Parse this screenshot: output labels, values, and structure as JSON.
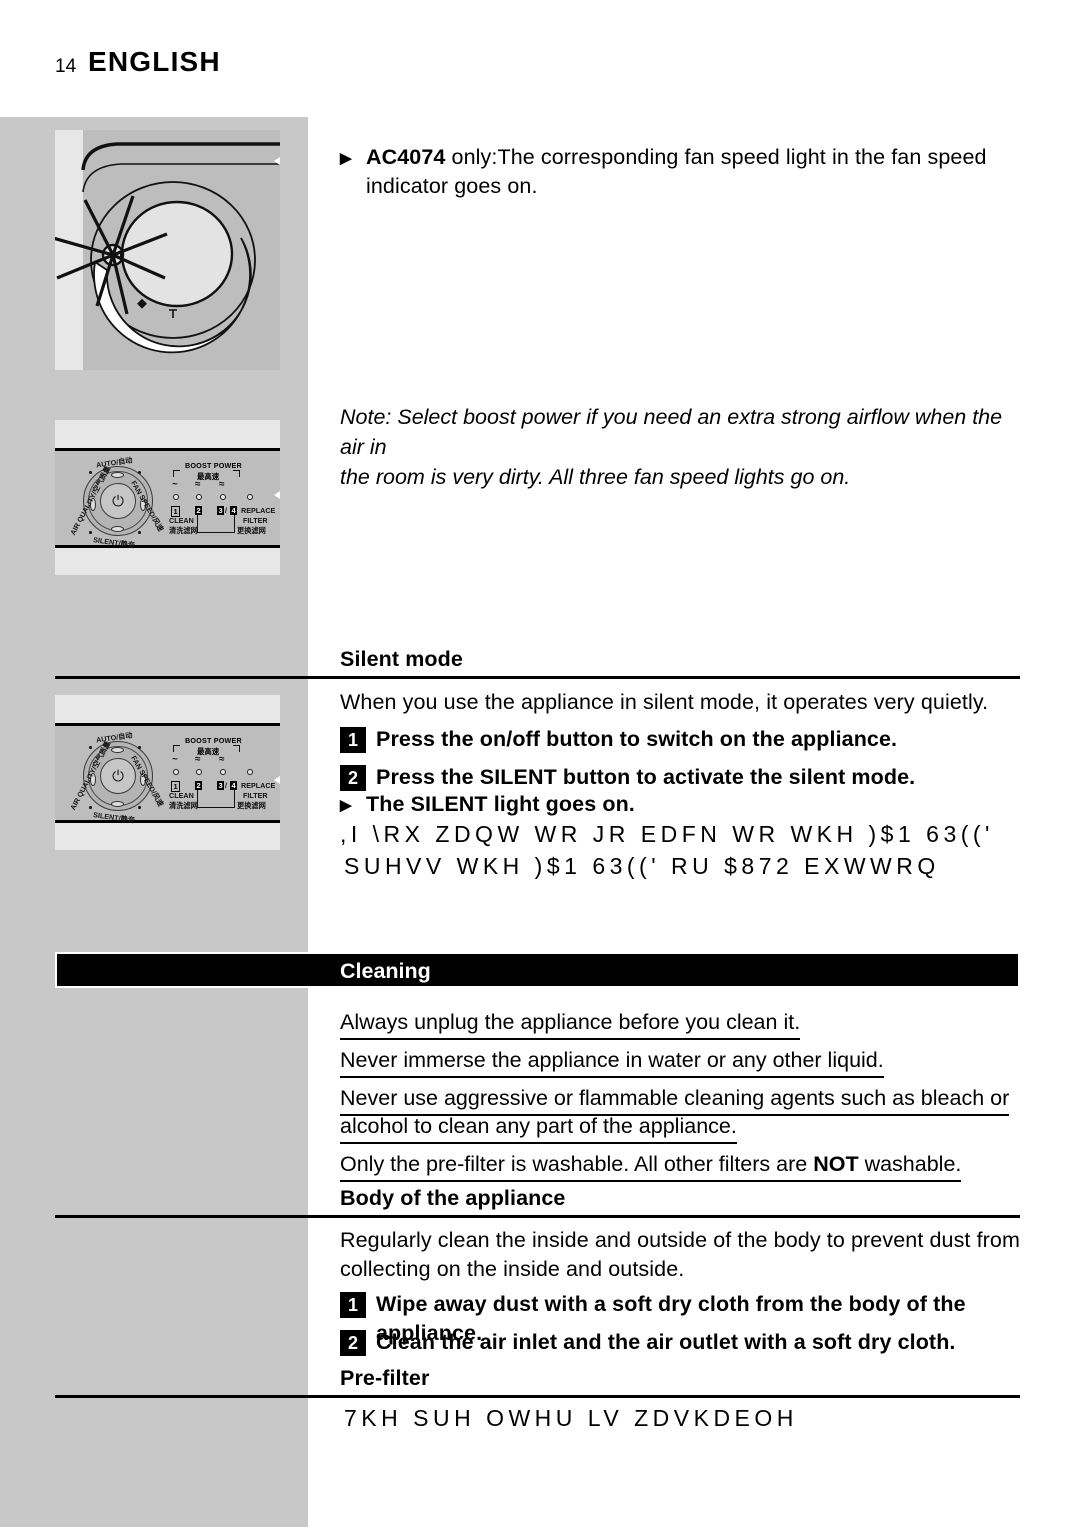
{
  "page": {
    "number": "14",
    "title": "ENGLISH"
  },
  "bullets": {
    "ac4074": {
      "bold_prefix": "AC4074",
      "rest": " only:The corresponding fan speed light in the fan speed",
      "line2": "indicator goes on."
    },
    "silent_light": {
      "pre": "The ",
      "bold": "SILENT",
      "post": " light goes on."
    }
  },
  "note": {
    "line1": "Note: Select boost power if you need an extra strong airflow when the air in",
    "line2": "the room is very dirty. All three fan speed lights go on."
  },
  "silent_mode": {
    "heading": "Silent mode",
    "intro": "When you use the appliance in silent mode, it operates very quietly.",
    "steps": [
      {
        "number": "1",
        "text": "Press the on/off button to switch on the appliance."
      },
      {
        "number": "2",
        "pre": "Press the ",
        "bold": "SILENT",
        "post": " button to activate the silent mode."
      }
    ],
    "garbled": [
      ",I \\RX ZDQW WR JR EDFN WR WKH )$1 63(('",
      "SUHVV WKH )$1 63((' RU $872 EXWWRQ"
    ]
  },
  "cleaning": {
    "banner_label": "Cleaning",
    "warnings": [
      "Always unplug the appliance before you clean it.",
      "Never immerse the appliance in water or any other liquid.",
      "Never use aggressive or flammable cleaning agents such as bleach or",
      "alcohol to clean any part of the appliance."
    ],
    "prefilter_note": {
      "pre": "Only the pre-filter is washable. All other filters are ",
      "bold": "NOT",
      "post": " washable."
    }
  },
  "body_section": {
    "heading": "Body of the appliance",
    "intro_line1": "Regularly clean the inside and outside of the body to prevent dust from",
    "intro_line2": "collecting on the inside and outside.",
    "steps": [
      {
        "number": "1",
        "text": "Wipe away dust with a soft dry cloth from the body of the appliance."
      },
      {
        "number": "2",
        "text": "Clean the air inlet and the air outlet with a soft dry cloth."
      }
    ]
  },
  "prefilter_section": {
    "heading": "Pre-filter",
    "garbled": "7KH SUH  OWHU LV ZDVKDEOH"
  },
  "figures": {
    "dial_closeup": {
      "caption": ""
    },
    "control_panel": {
      "power_glyph": "⏻",
      "labels": {
        "auto": "AUTO/自动",
        "fan_speed": "FAN SPEED/风速",
        "silent": "SILENT/静音",
        "air_quality": "AIR QUALITY/空气质量"
      },
      "boost_power": "BOOST POWER",
      "boost_power_cn": "最高速",
      "indicator_numbers": [
        "1",
        "2",
        "3",
        "4"
      ],
      "clean": "CLEAN",
      "clean_cn": "清洗滤网",
      "replace": "REPLACE",
      "filter": "FILTER",
      "replace_cn": "更换滤网",
      "waves": [
        "~",
        "≈",
        "≈"
      ]
    }
  },
  "colors": {
    "grey_column": "#c8c8c8",
    "figure_bg": "#e4e4e4",
    "panel_art": "#bdbdbd",
    "banner_bg": "#000000",
    "banner_text": "#ffffff"
  }
}
